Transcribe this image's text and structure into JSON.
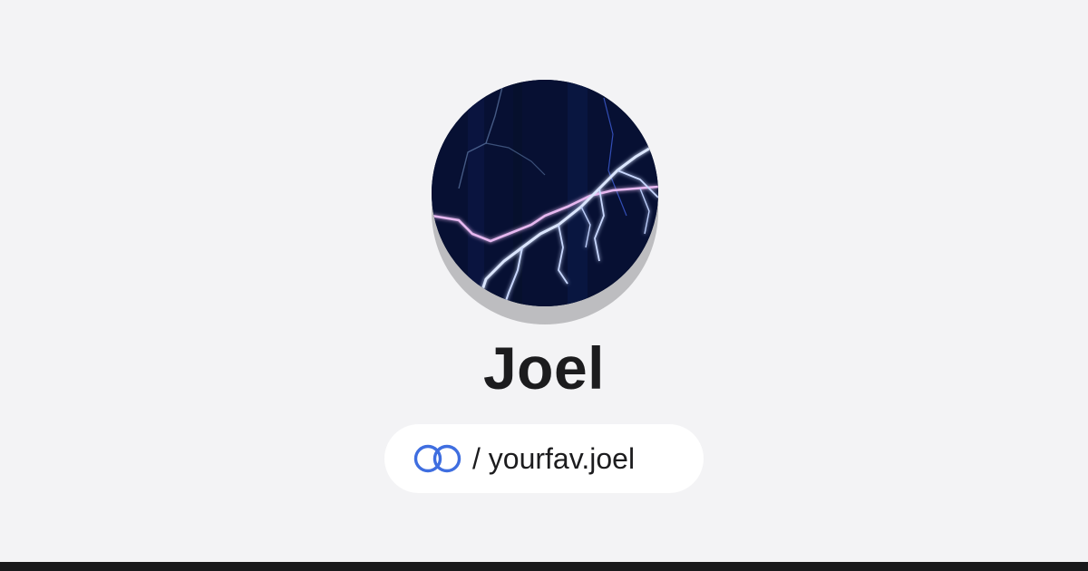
{
  "profile": {
    "name": "Joel",
    "avatar_icon": "lightning-avatar",
    "handle_prefix": "/ ",
    "handle": "yourfav.joel",
    "link_icon": "linked-rings-icon"
  },
  "colors": {
    "background": "#f3f3f5",
    "accent": "#3f6ee0",
    "text": "#1c1c1e",
    "bottom_bar": "#19191b"
  }
}
